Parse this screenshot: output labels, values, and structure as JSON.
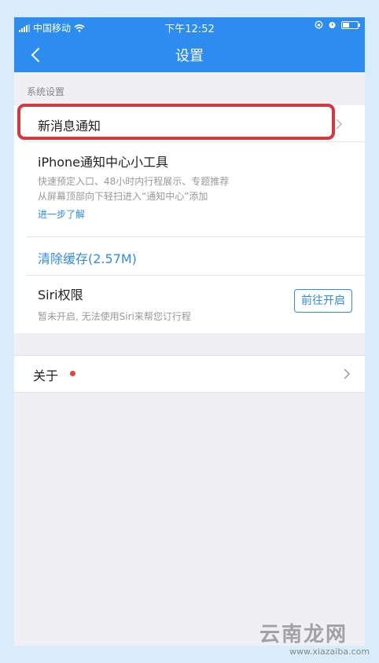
{
  "status_bar": {
    "carrier": "中国移动",
    "time": "下午12:52"
  },
  "nav": {
    "title": "设置"
  },
  "section": {
    "system_header": "系统设置"
  },
  "rows": {
    "new_message": {
      "label": "新消息通知"
    },
    "iphone_widget": {
      "title": "iPhone通知中心小工具",
      "desc_line1": "快速预定入口、48小时内行程展示、专题推荐",
      "desc_line2": "从屏幕顶部向下轻扫进入“通知中心”添加",
      "link": "进一步了解"
    },
    "clear_cache": {
      "label": "清除缓存(2.57M)"
    },
    "siri": {
      "title": "Siri权限",
      "desc": "暂未开启, 无法使用Siri来帮您订行程",
      "button": "前往开启"
    },
    "about": {
      "label": "关于"
    }
  },
  "watermark": {
    "brand": "云南龙网",
    "url": "www.xiazaiba.com"
  },
  "colors": {
    "accent": "#2d8cf0",
    "highlight_border": "#d8383b",
    "badge_dot": "#e0473a",
    "page_bg": "#efeff4"
  },
  "icons": [
    "back-chevron-icon",
    "wifi-icon",
    "signal-icon",
    "lock-rotation-icon",
    "alarm-icon",
    "battery-icon",
    "chevron-right-icon"
  ]
}
